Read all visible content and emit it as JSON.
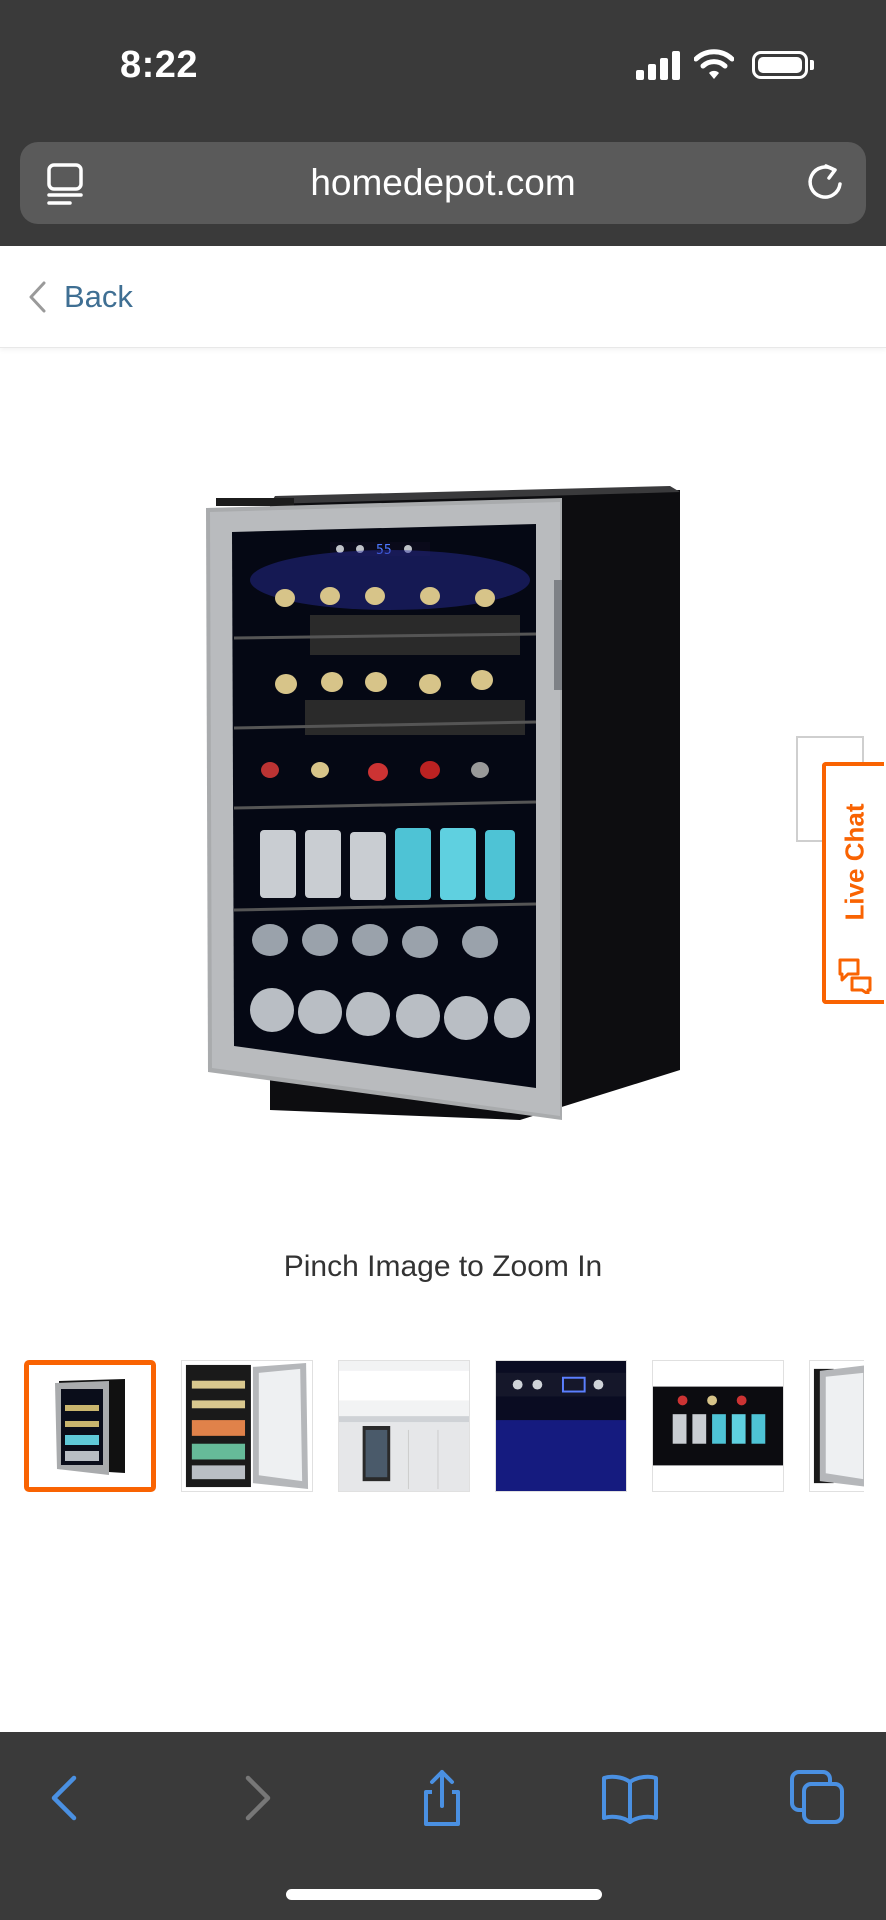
{
  "status_bar": {
    "time": "8:22"
  },
  "browser": {
    "url": "homedepot.com"
  },
  "header": {
    "back_label": "Back"
  },
  "product": {
    "zoom_hint": "Pinch Image to Zoom In",
    "display_temperature": "55"
  },
  "live_chat": {
    "label": "Live Chat"
  },
  "thumbnails": {
    "count": 6,
    "selected_index": 0,
    "items": [
      "fridge-front",
      "fridge-open-door",
      "fridge-in-kitchen",
      "control-panel-closeup",
      "shelves-closeup",
      "door-open-partial"
    ]
  },
  "colors": {
    "brand_orange": "#f96302",
    "link_blue": "#3f6f93",
    "ios_blue": "#4a90e2",
    "chrome_dark": "#3a3a3a"
  },
  "toolbar": {
    "icons": [
      "back-arrow-icon",
      "forward-arrow-icon",
      "share-icon",
      "bookmarks-icon",
      "tabs-icon"
    ]
  }
}
